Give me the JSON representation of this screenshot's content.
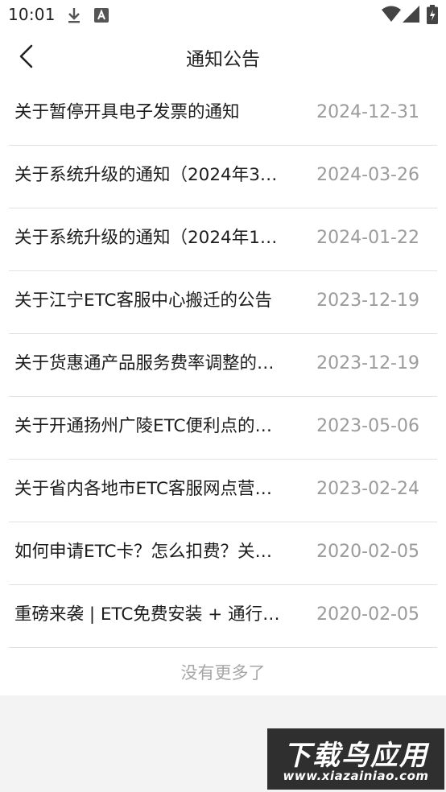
{
  "status_bar": {
    "time": "10:01",
    "icons": [
      "download-icon",
      "notification-a-icon",
      "wifi-icon",
      "signal-icon",
      "battery-charging-icon"
    ]
  },
  "nav": {
    "back_icon": "chevron-left-icon",
    "title": "通知公告"
  },
  "notices": [
    {
      "title": "关于暂停开具电子发票的通知",
      "date": "2024-12-31"
    },
    {
      "title": "关于系统升级的通知（2024年3…",
      "date": "2024-03-26"
    },
    {
      "title": "关于系统升级的通知（2024年1…",
      "date": "2024-01-22"
    },
    {
      "title": "关于江宁ETC客服中心搬迁的公告",
      "date": "2023-12-19"
    },
    {
      "title": "关于货惠通产品服务费率调整的…",
      "date": "2023-12-19"
    },
    {
      "title": "关于开通扬州广陵ETC便利点的…",
      "date": "2023-05-06"
    },
    {
      "title": "关于省内各地市ETC客服网点营…",
      "date": "2023-02-24"
    },
    {
      "title": "如何申请ETC卡？怎么扣费？关…",
      "date": "2020-02-05"
    },
    {
      "title": "重磅来袭 | ETC免费安装 + 通行…",
      "date": "2020-02-05"
    }
  ],
  "footer": {
    "no_more": "没有更多了"
  },
  "watermark": {
    "main": "下载鸟应用",
    "url": "www.xiazainiao.com"
  }
}
